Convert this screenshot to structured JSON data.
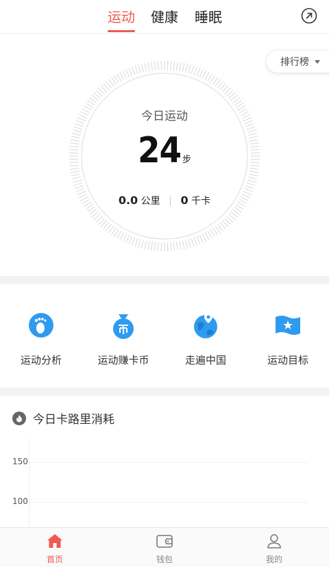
{
  "tabs": [
    "运动",
    "健康",
    "睡眠"
  ],
  "rank_button": "排行榜",
  "today": {
    "label": "今日运动",
    "steps": "24",
    "steps_unit": "步",
    "distance": "0.0",
    "distance_unit": "公里",
    "calories": "0",
    "calories_unit": "千卡"
  },
  "features": [
    {
      "label": "运动分析",
      "icon": "footprint-icon"
    },
    {
      "label": "运动赚卡币",
      "icon": "coin-bag-icon"
    },
    {
      "label": "走遍中国",
      "icon": "globe-pin-icon"
    },
    {
      "label": "运动目标",
      "icon": "flag-star-icon"
    }
  ],
  "calorie_section": {
    "title": "今日卡路里消耗",
    "icon": "fire-icon"
  },
  "chart_data": {
    "type": "bar",
    "title": "",
    "ytick_labels": [
      "150",
      "100"
    ],
    "y_ticks": [
      150,
      100
    ],
    "values": []
  },
  "bottom_nav": [
    {
      "label": "首页",
      "icon": "home-icon",
      "active": true
    },
    {
      "label": "钱包",
      "icon": "wallet-icon",
      "active": false
    },
    {
      "label": "我的",
      "icon": "profile-icon",
      "active": false
    }
  ],
  "colors": {
    "accent": "#ef5a4e",
    "feature_blue": "#2f9bf0"
  }
}
